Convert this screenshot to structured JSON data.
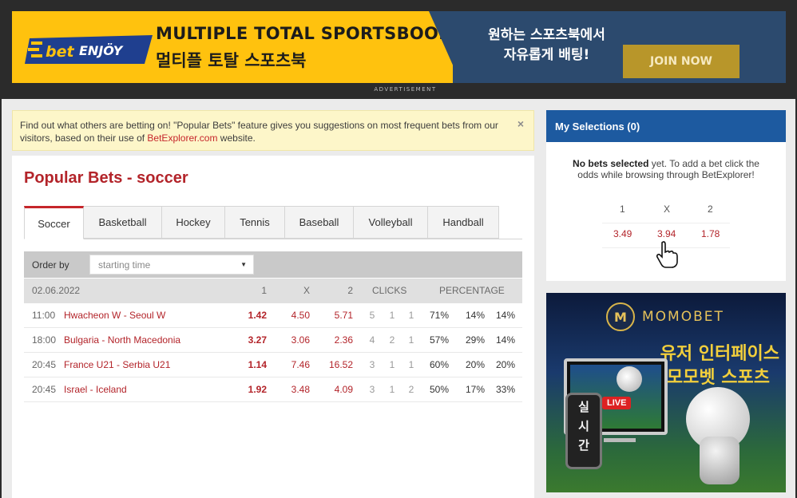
{
  "ad_top": {
    "logo_bet": "bet",
    "logo_enjoy": "ENJÖY",
    "title_en": "MULTIPLE TOTAL SPORTSBOOK",
    "title_ko": "멀티플 토탈 스포츠북",
    "right_line1": "원하는 스포츠북에서",
    "right_line2": "자유롭게 배팅!",
    "join_label": "JOIN NOW",
    "caption": "ADVERTISEMENT",
    "colors": {
      "yellow": "#ffc20e",
      "navy": "#2c4a6e",
      "button": "#b8962a"
    }
  },
  "info": {
    "text_before": "Find out what others are betting on! \"Popular Bets\" feature gives you suggestions on most frequent bets from our visitors, based on their use of ",
    "link": "BetExplorer.com",
    "text_after": " website.",
    "close": "×"
  },
  "page_title": "Popular Bets - soccer",
  "tabs": [
    {
      "label": "Soccer",
      "active": true
    },
    {
      "label": "Basketball",
      "active": false
    },
    {
      "label": "Hockey",
      "active": false
    },
    {
      "label": "Tennis",
      "active": false
    },
    {
      "label": "Baseball",
      "active": false
    },
    {
      "label": "Volleyball",
      "active": false
    },
    {
      "label": "Handball",
      "active": false
    }
  ],
  "order": {
    "label": "Order by",
    "selected": "starting time"
  },
  "table": {
    "date": "02.06.2022",
    "col_1": "1",
    "col_x": "X",
    "col_2": "2",
    "col_clicks": "CLICKS",
    "col_pct": "PERCENTAGE",
    "rows": [
      {
        "time": "11:00",
        "match": "Hwacheon W - Seoul W",
        "o1": "1.42",
        "ox": "4.50",
        "o2": "5.71",
        "k1": "5",
        "k2": "1",
        "k3": "1",
        "p1": "71%",
        "p2": "14%",
        "p3": "14%"
      },
      {
        "time": "18:00",
        "match": "Bulgaria - North Macedonia",
        "o1": "3.27",
        "ox": "3.06",
        "o2": "2.36",
        "k1": "4",
        "k2": "2",
        "k3": "1",
        "p1": "57%",
        "p2": "29%",
        "p3": "14%"
      },
      {
        "time": "20:45",
        "match": "France U21 - Serbia U21",
        "o1": "1.14",
        "ox": "7.46",
        "o2": "16.52",
        "k1": "3",
        "k2": "1",
        "k3": "1",
        "p1": "60%",
        "p2": "20%",
        "p3": "20%"
      },
      {
        "time": "20:45",
        "match": "Israel - Iceland",
        "o1": "1.92",
        "ox": "3.48",
        "o2": "4.09",
        "k1": "3",
        "k2": "1",
        "k3": "2",
        "p1": "50%",
        "p2": "17%",
        "p3": "33%"
      }
    ]
  },
  "selections": {
    "title": "My Selections (0)",
    "bold": "No bets selected",
    "text": " yet. To add a bet click the odds while browsing through BetExplorer!",
    "h1": "1",
    "hx": "X",
    "h2": "2",
    "v1": "3.49",
    "vx": "3.94",
    "v2": "1.78"
  },
  "ad_side": {
    "logo_letter": "M",
    "brand": "MOMOBET",
    "line1": "유저 인터페이스",
    "line2": "모모벳 스포츠",
    "live": "LIVE",
    "phone_1": "실",
    "phone_2": "시",
    "phone_3": "간"
  },
  "accent": "#c6262b",
  "header_blue": "#1d5aa0"
}
